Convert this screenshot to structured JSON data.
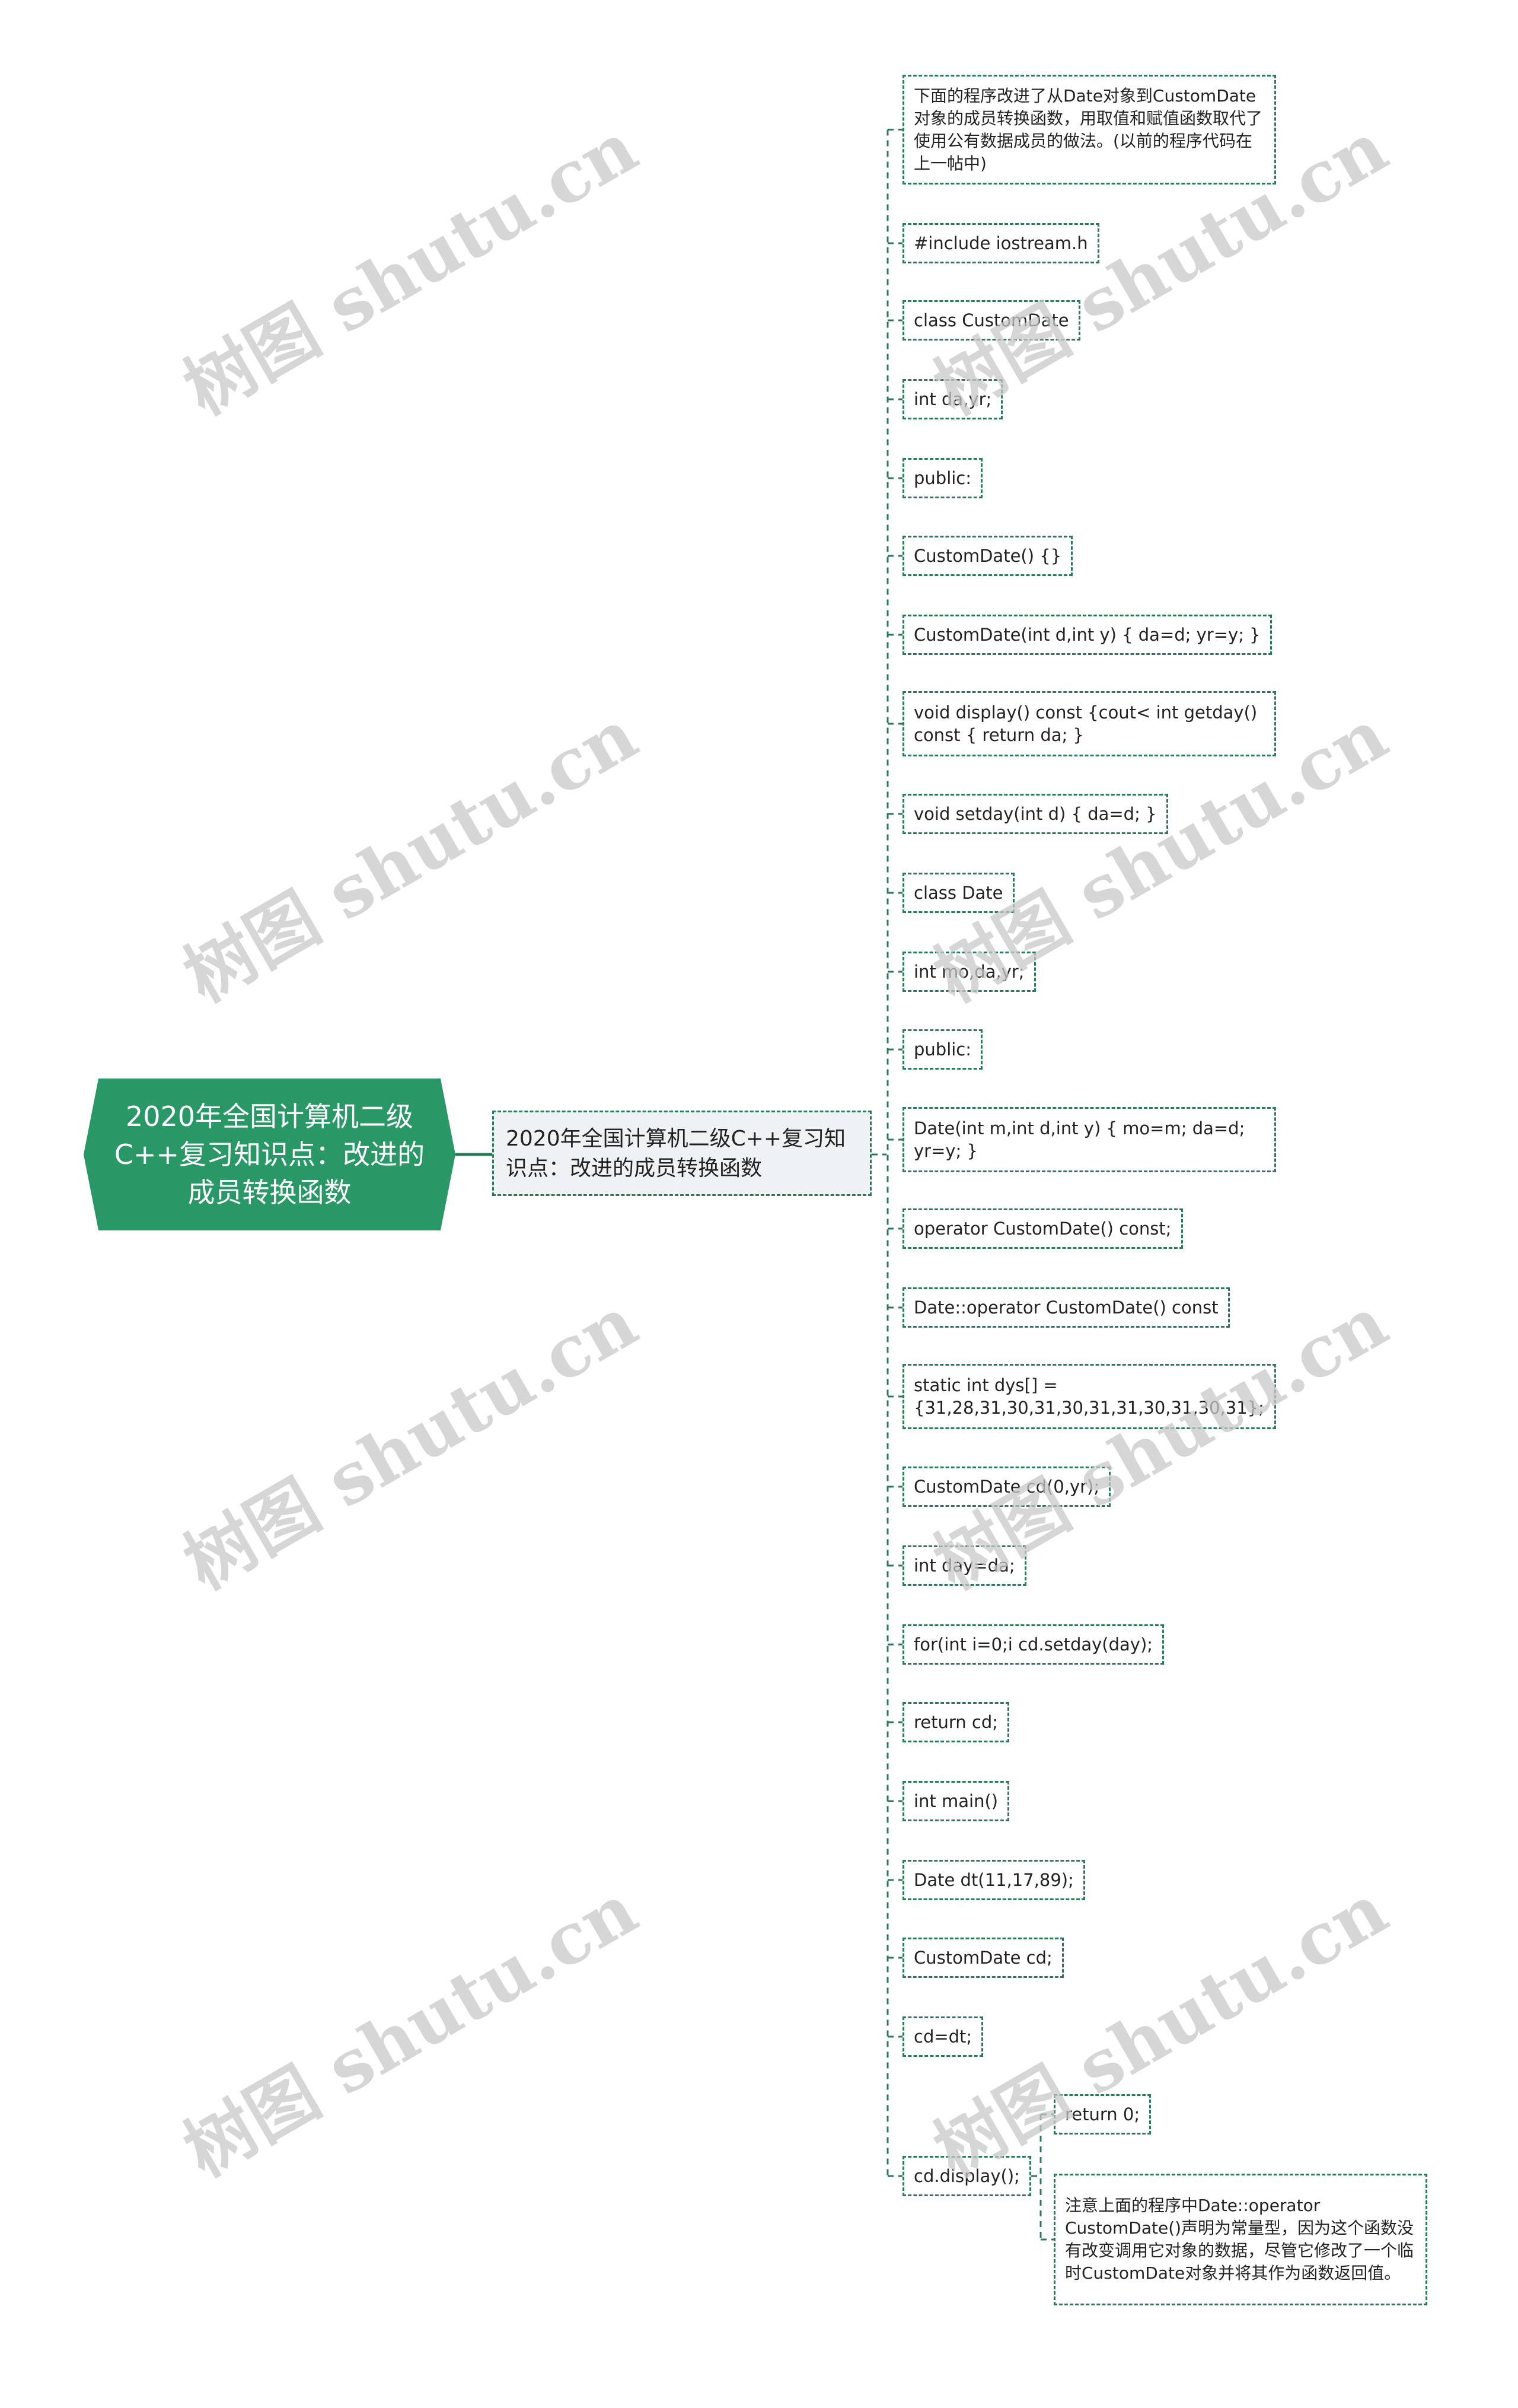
{
  "root": {
    "label": "2020年全国计算机二级C++复习知识点：改进的成员转换函数"
  },
  "main_node": {
    "label": "2020年全国计算机二级C++复习知识点：改进的成员转换函数"
  },
  "leaves": [
    {
      "label": "下面的程序改进了从Date对象到CustomDate对象的成员转换函数，用取值和赋值函数取代了使用公有数据成员的做法。(以前的程序代码在上一帖中)"
    },
    {
      "label": "#include iostream.h"
    },
    {
      "label": "class CustomDate"
    },
    {
      "label": "int da,yr;"
    },
    {
      "label": "public:"
    },
    {
      "label": "CustomDate() {}"
    },
    {
      "label": "CustomDate(int d,int y) { da=d; yr=y; }"
    },
    {
      "label": "void display() const {cout< int getday() const { return da; }"
    },
    {
      "label": "void setday(int d) { da=d; }"
    },
    {
      "label": "class Date"
    },
    {
      "label": "int mo,da,yr;"
    },
    {
      "label": "public:"
    },
    {
      "label": "Date(int m,int d,int y) { mo=m; da=d; yr=y; }"
    },
    {
      "label": "operator CustomDate() const;"
    },
    {
      "label": "Date::operator CustomDate() const"
    },
    {
      "label": "static int dys[] = {31,28,31,30,31,30,31,31,30,31,30,31};"
    },
    {
      "label": "CustomDate cd(0,yr);"
    },
    {
      "label": "int day=da;"
    },
    {
      "label": "for(int i=0;i cd.setday(day);"
    },
    {
      "label": "return cd;"
    },
    {
      "label": "int main()"
    },
    {
      "label": "Date dt(11,17,89);"
    },
    {
      "label": "CustomDate cd;"
    },
    {
      "label": "cd=dt;"
    },
    {
      "label": "cd.display();"
    }
  ],
  "sub_leaves": [
    {
      "label": "return 0;"
    },
    {
      "label": "注意上面的程序中Date::operator CustomDate()声明为常量型，因为这个函数没有改变调用它对象的数据，尽管它修改了一个临时CustomDate对象并将其作为函数返回值。"
    }
  ],
  "watermark": {
    "text": "树图 shutu.cn"
  },
  "colors": {
    "root_fill": "#2a9866",
    "border": "#2a7a57",
    "main_fill": "#eff2f5",
    "watermark": "#d0d0d0"
  }
}
